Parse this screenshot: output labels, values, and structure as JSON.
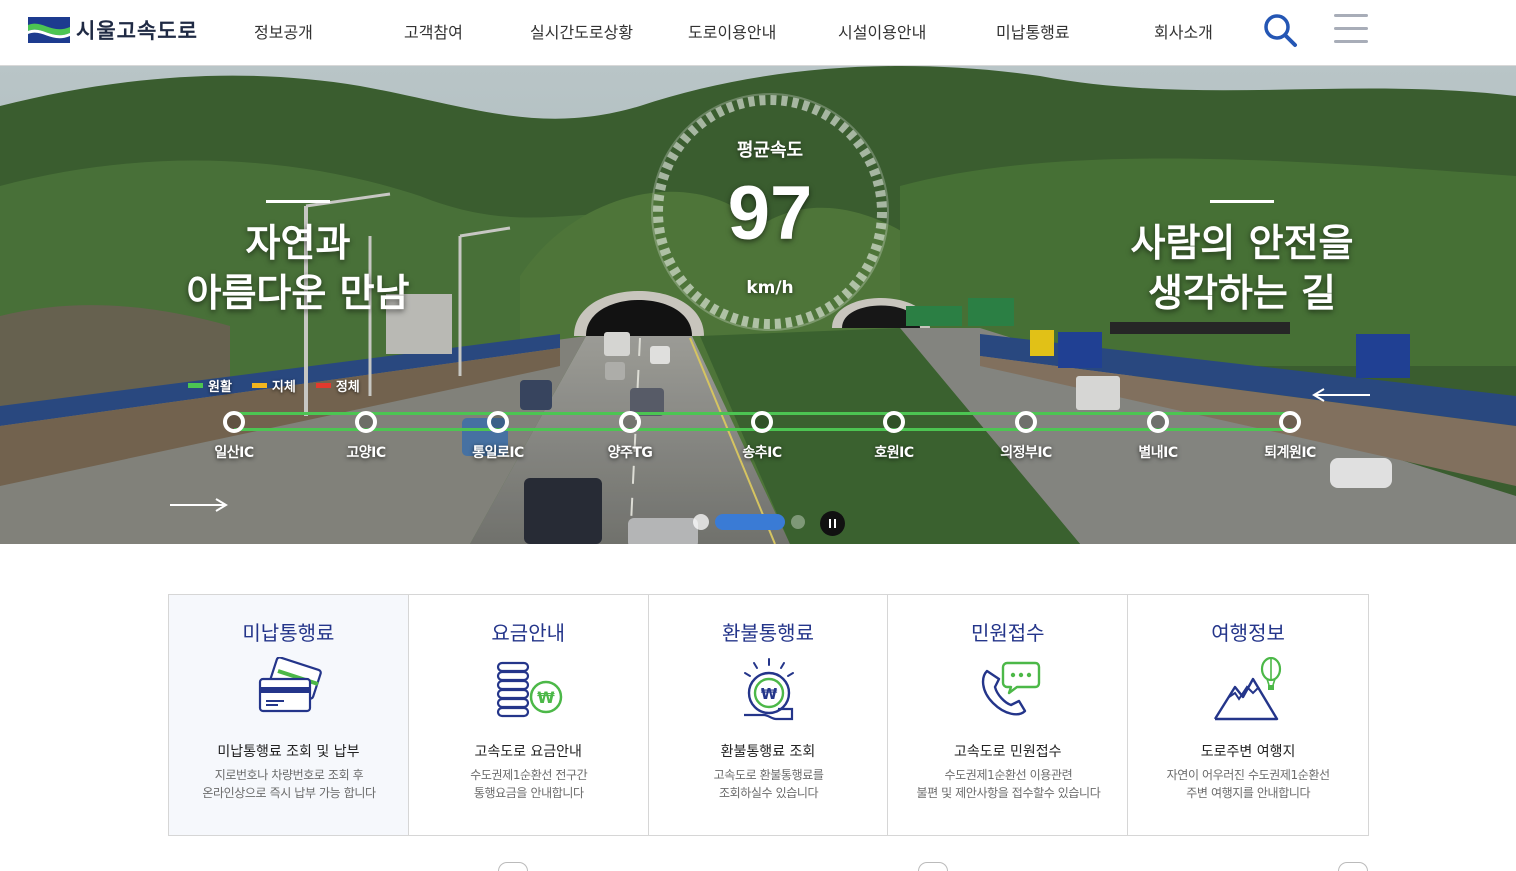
{
  "brand": {
    "name": "시울고속도로"
  },
  "nav": {
    "items": [
      {
        "label": "정보공개"
      },
      {
        "label": "고객참여"
      },
      {
        "label": "실시간도로상황"
      },
      {
        "label": "도로이용안내"
      },
      {
        "label": "시설이용안내"
      },
      {
        "label": "미납통행료"
      },
      {
        "label": "회사소개"
      }
    ],
    "search_icon": "search-icon",
    "menu_icon": "hamburger-menu-icon"
  },
  "hero": {
    "left_slogan": [
      "자연과",
      "아름다운 만남"
    ],
    "right_slogan": [
      "사람의 안전을",
      "생각하는 길"
    ],
    "gauge": {
      "title": "평균속도",
      "value": "97",
      "unit": "km/h"
    },
    "legend": [
      {
        "label": "원활",
        "color": "#4cc552"
      },
      {
        "label": "지체",
        "color": "#f2b51e"
      },
      {
        "label": "정체",
        "color": "#e23a2d"
      }
    ],
    "stations": [
      {
        "label": "일산IC"
      },
      {
        "label": "고양IC"
      },
      {
        "label": "통일로IC"
      },
      {
        "label": "양주TG"
      },
      {
        "label": "송추IC"
      },
      {
        "label": "호원IC"
      },
      {
        "label": "의정부IC"
      },
      {
        "label": "별내IC"
      },
      {
        "label": "퇴계원IC"
      }
    ],
    "route_color": "#4cc552",
    "pager": {
      "active": 2,
      "total": 3
    }
  },
  "quick_menu": [
    {
      "title": "미납통행료",
      "subtitle": "미납통행료 조회 및 납부",
      "desc": [
        "지로번호나 차량번호로 조회 후",
        "온라인상으로 즉시 납부 가능 합니다"
      ],
      "icon": "credit-card-icon"
    },
    {
      "title": "요금안내",
      "subtitle": "고속도로 요금안내",
      "desc": [
        "수도권제1순환선 전구간",
        "통행요금을 안내합니다"
      ],
      "icon": "coin-stack-won-icon"
    },
    {
      "title": "환불통행료",
      "subtitle": "환불통행료 조회",
      "desc": [
        "고속도로 환불통행료를",
        "조회하실수 있습니다"
      ],
      "icon": "won-coin-refund-icon"
    },
    {
      "title": "민원접수",
      "subtitle": "고속도로 민원접수",
      "desc": [
        "수도권제1순환선 이용관련",
        "불편 및 제안사항을 접수할수 있습니다"
      ],
      "icon": "phone-chat-icon"
    },
    {
      "title": "여행정보",
      "subtitle": "도로주변 여행지",
      "desc": [
        "자연이 어우러진 수도권제1순환선",
        "주변 여행지를 안내합니다"
      ],
      "icon": "mountain-balloon-icon"
    }
  ],
  "colors": {
    "accent": "#24358a",
    "brand_blue": "#1b4f9c",
    "pager_active": "#3a7bd5"
  }
}
